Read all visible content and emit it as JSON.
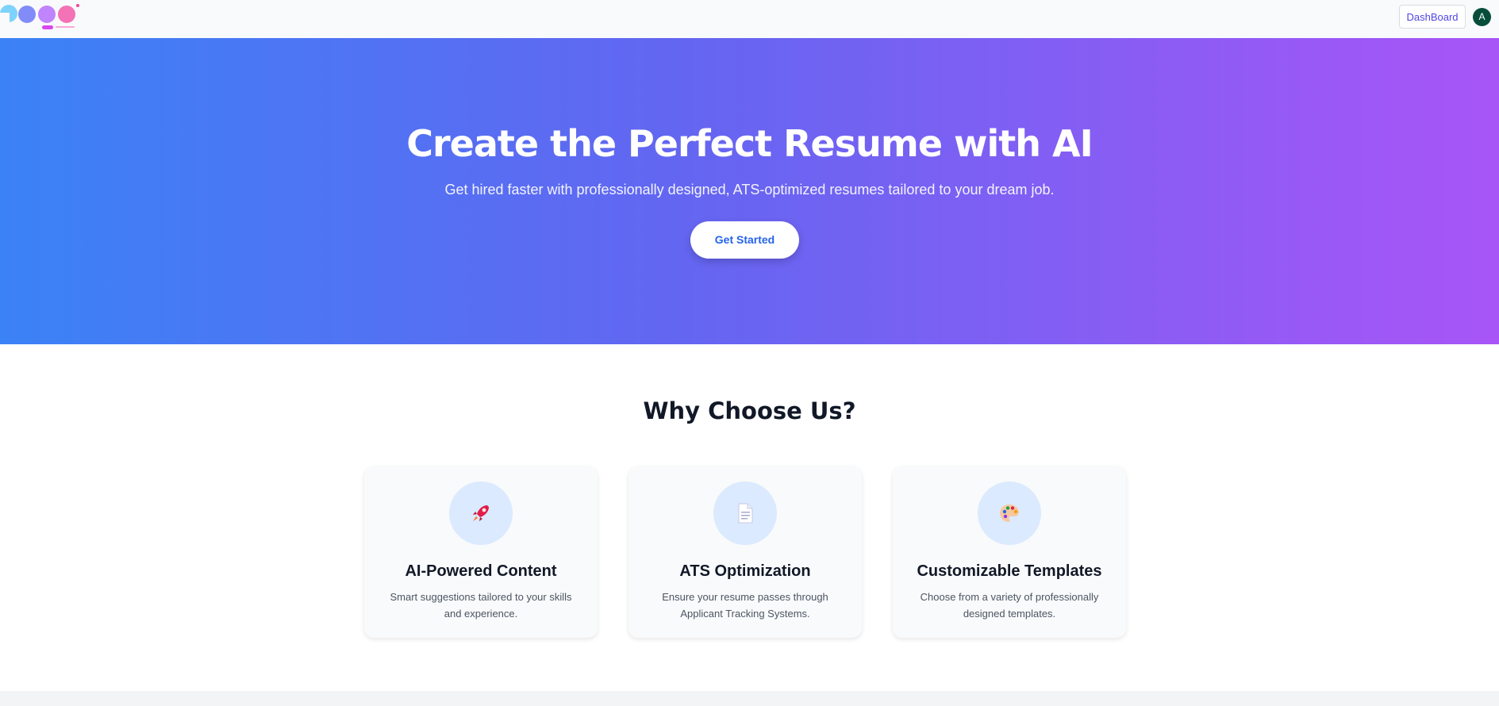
{
  "header": {
    "logo_alt": "Logo",
    "dashboard_label": "DashBoard",
    "avatar_initial": "A"
  },
  "hero": {
    "title": "Create the Perfect Resume with AI",
    "subtitle": "Get hired faster with professionally designed, ATS-optimized resumes tailored to your dream job.",
    "cta_label": "Get Started"
  },
  "features": {
    "title": "Why Choose Us?",
    "items": [
      {
        "icon": "rocket-icon",
        "title": "AI-Powered Content",
        "desc": "Smart suggestions tailored to your skills and experience."
      },
      {
        "icon": "document-icon",
        "title": "ATS Optimization",
        "desc": "Ensure your resume passes through Applicant Tracking Systems."
      },
      {
        "icon": "palette-icon",
        "title": "Customizable Templates",
        "desc": "Choose from a variety of professionally designed templates."
      }
    ]
  },
  "colors": {
    "gradient_start": "#3b82f6",
    "gradient_end": "#a855f7",
    "accent": "#2563eb",
    "avatar_bg": "#064e3b"
  }
}
